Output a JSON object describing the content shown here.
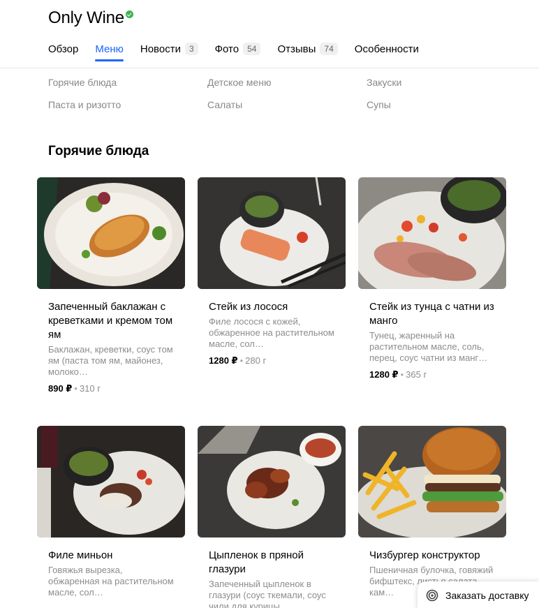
{
  "header": {
    "title": "Only Wine",
    "tabs": [
      {
        "label": "Обзор",
        "count": null
      },
      {
        "label": "Меню",
        "count": null
      },
      {
        "label": "Новости",
        "count": "3"
      },
      {
        "label": "Фото",
        "count": "54"
      },
      {
        "label": "Отзывы",
        "count": "74"
      },
      {
        "label": "Особенности",
        "count": null
      }
    ]
  },
  "categories": [
    "Горячие блюда",
    "Детское меню",
    "Закуски",
    "Паста и ризотто",
    "Салаты",
    "Супы"
  ],
  "section": {
    "title": "Горячие блюда"
  },
  "dishes": [
    {
      "name": "Запеченный баклажан с креветками и кремом том ям",
      "desc": "Баклажан, креветки, соус том ям (паста том ям, майонез, молоко…",
      "price": "890 ₽",
      "weight": "310 г"
    },
    {
      "name": "Стейк из лосося",
      "desc": "Филе лосося с кожей, обжаренное на растительном масле, сол…",
      "price": "1280 ₽",
      "weight": "280 г"
    },
    {
      "name": "Стейк из тунца с чатни из манго",
      "desc": "Тунец, жаренный на растительном масле, соль, перец, соус чатни из манг…",
      "price": "1280 ₽",
      "weight": "365 г"
    },
    {
      "name": "Филе миньон",
      "desc": "Говяжья вырезка, обжаренная на растительном масле, сол…",
      "price": "",
      "weight": ""
    },
    {
      "name": "Цыпленок в пряной глазури",
      "desc": "Запеченный цыпленок в глазури (соус ткемали, соус чили для курицы…",
      "price": "",
      "weight": ""
    },
    {
      "name": "Чизбургер конструктор",
      "desc": "Пшеничная булочка, говяжий бифштекс, листья салата, кам…",
      "price": "",
      "weight": ""
    }
  ],
  "delivery_button": {
    "label": "Заказать доставку",
    "icon": "spiral-icon"
  },
  "colors": {
    "accent": "#1a66ff",
    "verified": "#3bb54a"
  }
}
